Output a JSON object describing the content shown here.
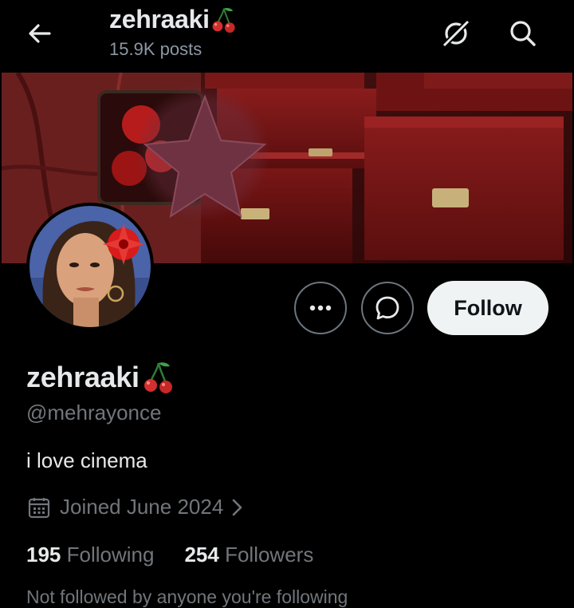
{
  "header": {
    "title": "zehraaki",
    "title_emoji": "cherries-icon",
    "posts_count": "15.9K posts",
    "back_icon": "arrow-left-icon",
    "grok_icon": "grok-icon",
    "search_icon": "search-icon"
  },
  "profile": {
    "display_name": "zehraaki",
    "handle": "@mehrayonce",
    "bio": "i love cinema",
    "joined": "Joined June 2024",
    "following_count": "195",
    "following_label": "Following",
    "followers_count": "254",
    "followers_label": "Followers",
    "followed_by": "Not followed by anyone you're following"
  },
  "actions": {
    "more_icon": "more-icon",
    "message_icon": "message-icon",
    "follow_label": "Follow"
  },
  "colors": {
    "background": "#000000",
    "text_primary": "#e7e9ea",
    "text_secondary": "#71767b",
    "follow_button_bg": "#eff3f4",
    "banner_red": "#7a1414"
  }
}
